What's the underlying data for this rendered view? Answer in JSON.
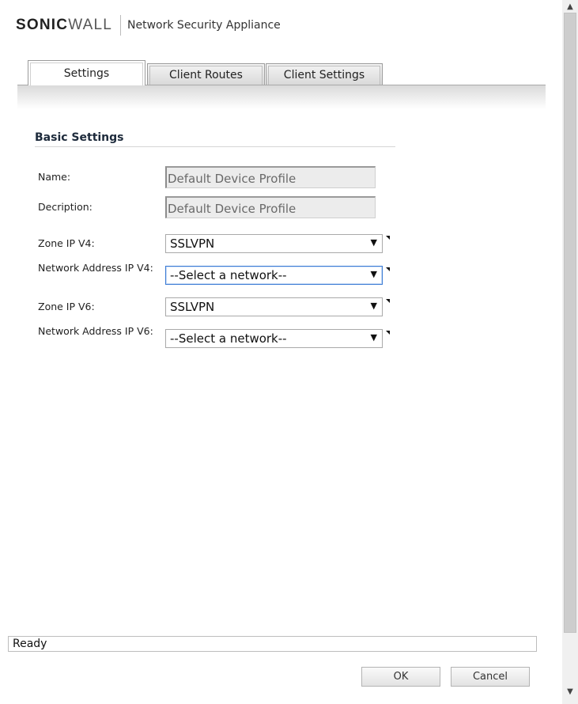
{
  "header": {
    "brand_prefix": "SONIC",
    "brand_suffix": "WALL",
    "product_name": "Network Security Appliance"
  },
  "tabs": [
    {
      "label": "Settings",
      "active": true
    },
    {
      "label": "Client Routes",
      "active": false
    },
    {
      "label": "Client Settings",
      "active": false
    }
  ],
  "basic_settings": {
    "title": "Basic Settings",
    "name_label": "Name:",
    "name_value": "Default Device Profile",
    "description_label": "Decription:",
    "description_value": "Default Device Profile",
    "zone_v4_label": "Zone IP V4:",
    "zone_v4_value": "SSLVPN",
    "network_v4_label": "Network Address IP V4:",
    "network_v4_value": "--Select a network--",
    "zone_v6_label": "Zone IP V6:",
    "zone_v6_value": "SSLVPN",
    "network_v6_label": "Network Address IP V6:",
    "network_v6_value": "--Select a network--"
  },
  "status": {
    "text": "Ready"
  },
  "buttons": {
    "ok": "OK",
    "cancel": "Cancel"
  },
  "icons": {
    "dropdown": "▼",
    "scroll_up": "▲",
    "scroll_down": "▼"
  },
  "colors": {
    "brand_accent": "#e07b1b",
    "focus_border": "#3a7ad4"
  }
}
